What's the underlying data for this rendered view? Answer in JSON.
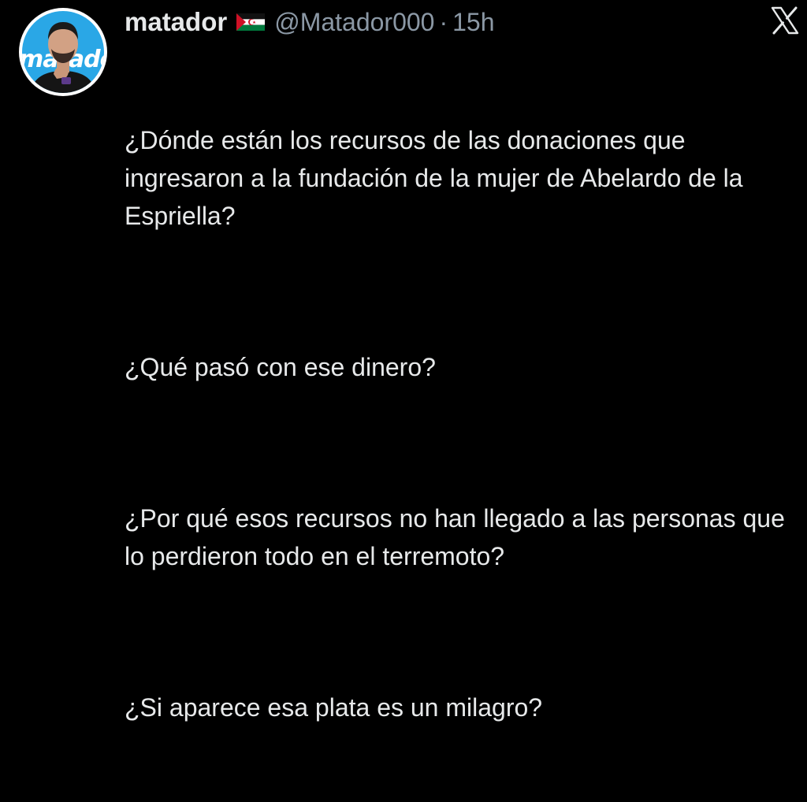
{
  "tweet": {
    "display_name": "matador",
    "flag_icon": "sahrawi-flag-icon",
    "handle": "@Matador000",
    "separator": "·",
    "time": "15h",
    "platform_icon": "x-logo-icon",
    "avatar": {
      "icon": "avatar-photo",
      "logo_text": "matador"
    },
    "paragraphs": [
      "¿Dónde están los recursos de las donaciones que ingresaron a la fundación de la mujer de Abelardo de la Espriella?",
      "¿Qué pasó con ese dinero?",
      "¿Por qué esos recursos no han llegado a las personas que lo perdieron todo en el terremoto?",
      "¿Si aparece esa plata es un milagro?"
    ]
  },
  "colors": {
    "background": "#000000",
    "text_primary": "#e7e9ea",
    "text_secondary": "#8b98a5",
    "avatar_bg": "#2aa7e6"
  }
}
